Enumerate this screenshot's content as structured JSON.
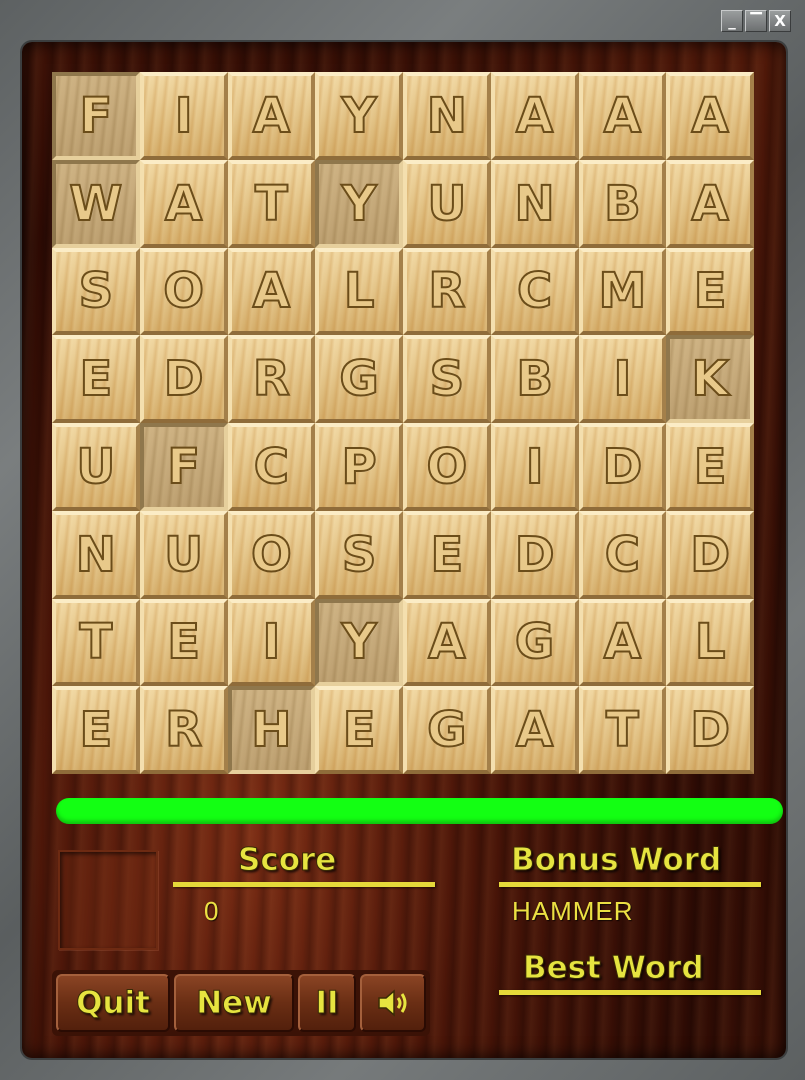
{
  "window": {
    "buttons": {
      "minimize": "_",
      "maximize": "▔",
      "close": "X"
    }
  },
  "board": {
    "rows": [
      [
        "F",
        "I",
        "A",
        "Y",
        "N",
        "A",
        "A",
        "A"
      ],
      [
        "W",
        "A",
        "T",
        "Y",
        "U",
        "N",
        "B",
        "A"
      ],
      [
        "S",
        "O",
        "A",
        "L",
        "R",
        "C",
        "M",
        "E"
      ],
      [
        "E",
        "D",
        "R",
        "G",
        "S",
        "B",
        "I",
        "K"
      ],
      [
        "U",
        "F",
        "C",
        "P",
        "O",
        "I",
        "D",
        "E"
      ],
      [
        "N",
        "U",
        "O",
        "S",
        "E",
        "D",
        "C",
        "D"
      ],
      [
        "T",
        "E",
        "I",
        "Y",
        "A",
        "G",
        "A",
        "L"
      ],
      [
        "E",
        "R",
        "H",
        "E",
        "G",
        "A",
        "T",
        "D"
      ]
    ],
    "dark_tiles": [
      "0-0",
      "1-0",
      "1-3",
      "3-7",
      "4-1",
      "6-3",
      "7-2"
    ]
  },
  "timer": {
    "fraction": 1.0,
    "color": "#13ff13"
  },
  "score": {
    "heading": "Score",
    "value": "0"
  },
  "bonus": {
    "heading": "Bonus Word",
    "value": "HAMMER"
  },
  "best": {
    "heading": "Best Word",
    "value": ""
  },
  "controls": {
    "quit": "Quit",
    "new": "New",
    "pause": "II",
    "sound_icon": "speaker-icon"
  },
  "colors": {
    "heading": "#e6e440",
    "timer": "#13ff13"
  }
}
